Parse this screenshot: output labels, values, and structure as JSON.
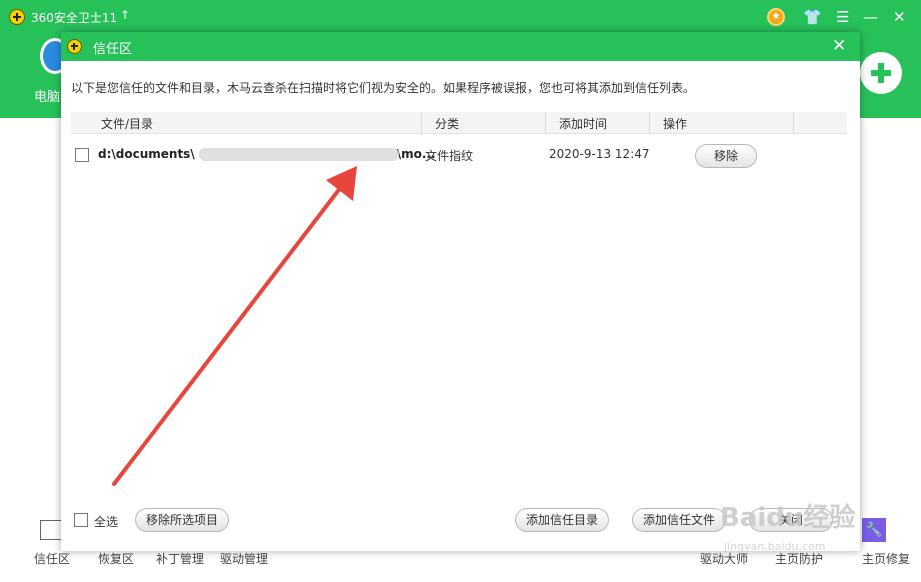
{
  "app": {
    "title": "360安全卫士11",
    "up_arrow": "↑",
    "pc_label": "电脑",
    "bottom_nav": [
      "信任区",
      "恢复区",
      "补丁管理",
      "驱动管理",
      "驱动大师",
      "主页防护",
      "主页修复"
    ]
  },
  "dialog": {
    "title": "信任区",
    "close_glyph": "✕",
    "description": "以下是您信任的文件和目录，木马云查杀在扫描时将它们视为安全的。如果程序被误报，您也可将其添加到信任列表。",
    "columns": [
      "文件/目录",
      "分类",
      "添加时间",
      "操作"
    ],
    "rows": [
      {
        "path": "d:\\documents\\",
        "path_end": "\\mo...",
        "category": "文件指纹",
        "time": "2020-9-13 12:47",
        "action": "移除"
      }
    ],
    "footer": {
      "select_all": "全选",
      "remove_selected": "移除所选项目",
      "add_dir": "添加信任目录",
      "add_file": "添加信任文件",
      "close": "关闭"
    }
  },
  "watermark": {
    "text": "Baidu经验",
    "sub": "jingyan.baidu.com"
  },
  "colors": {
    "accent": "#27c15a",
    "arrow": "#e8453c"
  }
}
